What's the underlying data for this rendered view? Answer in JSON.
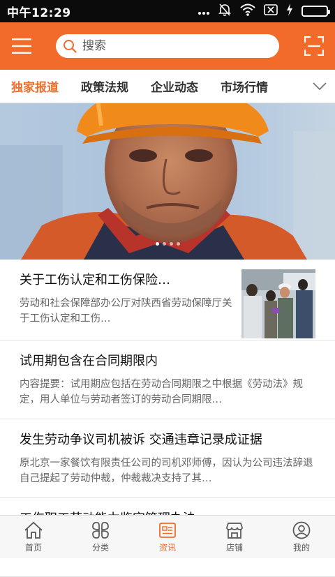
{
  "status_bar": {
    "time": "中午12:29"
  },
  "header": {
    "search_placeholder": "搜索"
  },
  "tabs": [
    {
      "label": "独家报道",
      "active": true
    },
    {
      "label": "政策法规",
      "active": false
    },
    {
      "label": "企业动态",
      "active": false
    },
    {
      "label": "市场行情",
      "active": false
    }
  ],
  "banner": {
    "slide_count": 4,
    "active_slide": 1
  },
  "news": [
    {
      "title": "关于工伤认定和工伤保险…",
      "desc": "劳动和社会保障部办公厅对陕西省劳动保障厅关于工伤认定和工伤…"
    },
    {
      "title": "试用期包含在合同期限内",
      "desc": "内容提要：试用期应包括在劳动合同期限之中根据《劳动法》规定，用人单位与劳动者签订的劳动合同期限…"
    },
    {
      "title": "发生劳动争议司机被诉 交通违章记录成证据",
      "desc": "原北京一家餐饮有限责任公司的司机邓师傅，因认为公司违法辞退自己提起了劳动仲裁，仲裁裁决支持了其…"
    },
    {
      "title": "工伤职工劳动能力鉴定管理办法",
      "desc": ""
    }
  ],
  "bottom_nav": [
    {
      "label": "首页",
      "icon": "home-icon",
      "active": false
    },
    {
      "label": "分类",
      "icon": "category-icon",
      "active": false
    },
    {
      "label": "资讯",
      "icon": "news-icon",
      "active": true
    },
    {
      "label": "店铺",
      "icon": "store-icon",
      "active": false
    },
    {
      "label": "我的",
      "icon": "profile-icon",
      "active": false
    }
  ],
  "colors": {
    "accent": "#f26b2b",
    "status_bar": "#0b0b0b",
    "battery": "#3ad13a"
  }
}
